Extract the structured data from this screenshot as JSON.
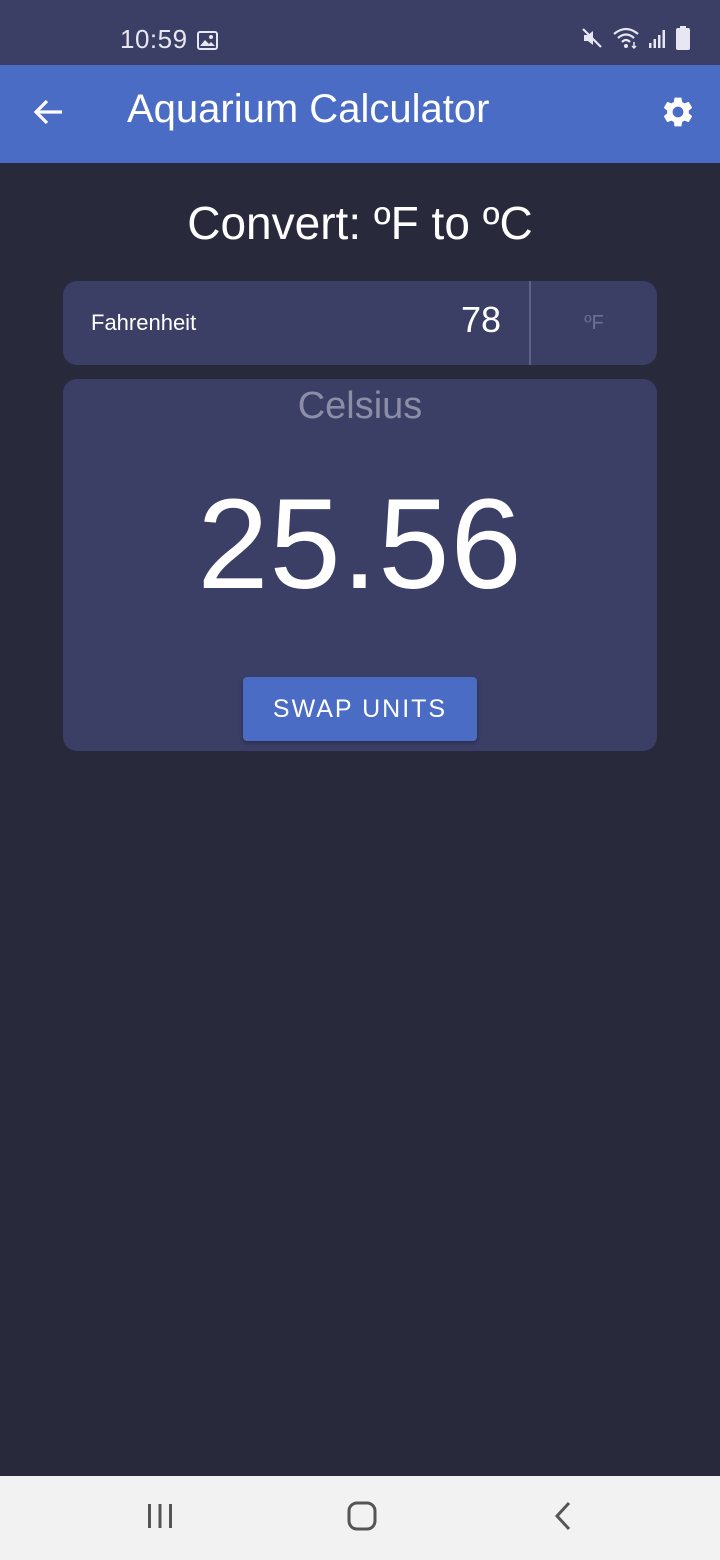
{
  "status_bar": {
    "time": "10:59",
    "icons": [
      "gallery-icon",
      "mute-icon",
      "wifi-icon",
      "signal-icon",
      "battery-icon"
    ]
  },
  "app_bar": {
    "title": "Aquarium Calculator",
    "back_icon": "arrow-left-icon",
    "settings_icon": "gear-icon",
    "color": "#4a6cc4"
  },
  "main": {
    "heading": "Convert: ºF to ºC",
    "input": {
      "label": "Fahrenheit",
      "value": "78",
      "unit": "ºF"
    },
    "result": {
      "label": "Celsius",
      "value": "25.56"
    },
    "swap_button_label": "SWAP UNITS"
  },
  "nav_bar": {
    "icons": [
      "recent-apps-icon",
      "home-icon",
      "back-nav-icon"
    ]
  },
  "colors": {
    "background": "#282a3c",
    "card": "#3b3f66",
    "accent": "#4a6cc4"
  }
}
